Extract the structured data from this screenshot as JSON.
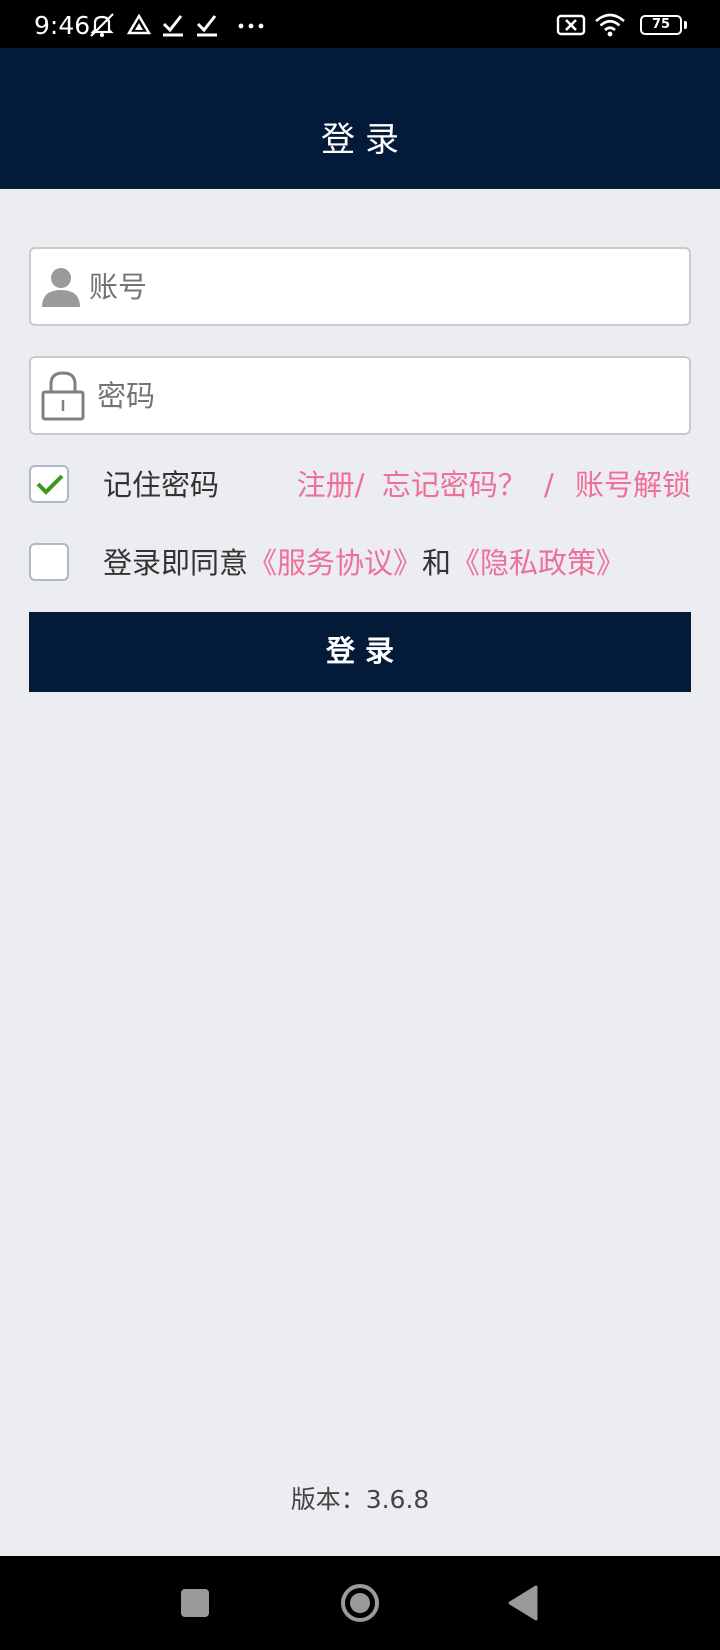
{
  "status_bar": {
    "time": "9:46",
    "battery": "75",
    "icons": [
      "mute-icon",
      "drive-icon",
      "check-icon",
      "check-icon",
      "more-dots-icon",
      "no-sim-icon",
      "wifi-icon",
      "battery-icon"
    ]
  },
  "header": {
    "title": "登录"
  },
  "form": {
    "account_placeholder": "账号",
    "password_placeholder": "密码",
    "remember_label": "记住密码",
    "remember_checked": true,
    "register_link": "注册/",
    "forgot_link": "忘记密码？",
    "separator": "/",
    "unlock_link": "账号解锁",
    "agree_checked": false,
    "agree_prefix": "登录即同意",
    "service_link": "《服务协议》",
    "agree_and": "和",
    "privacy_link": "《隐私政策》",
    "login_button": "登录"
  },
  "footer": {
    "version": "版本：3.6.8"
  },
  "colors": {
    "header_bg": "#031a38",
    "page_bg": "#ecedf1",
    "link": "#ee6f9a",
    "check": "#3a9a1e"
  }
}
